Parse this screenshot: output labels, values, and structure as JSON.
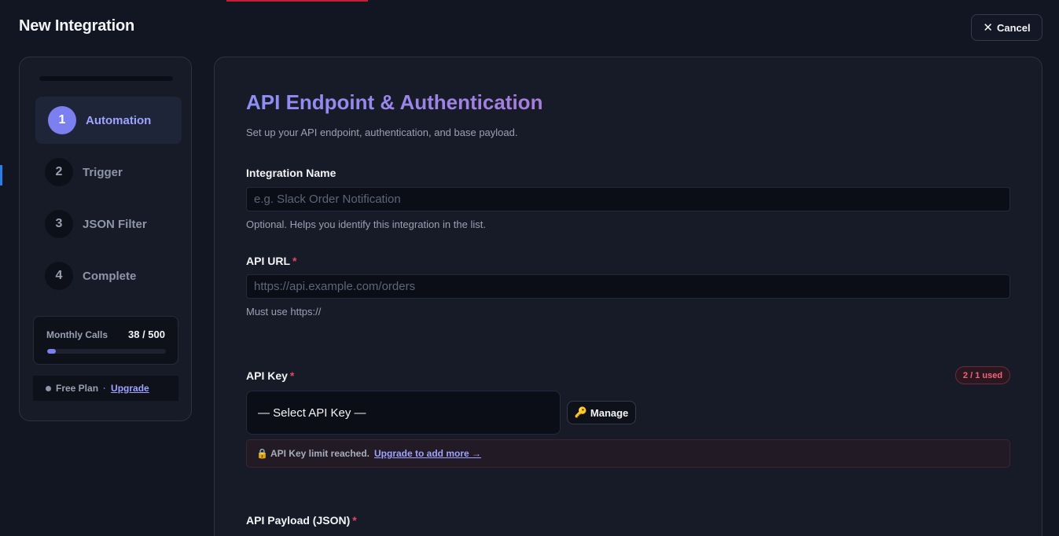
{
  "header": {
    "title": "New Integration",
    "cancel_label": "Cancel"
  },
  "sidebar": {
    "steps": [
      {
        "number": "1",
        "label": "Automation",
        "active": true
      },
      {
        "number": "2",
        "label": "Trigger",
        "active": false
      },
      {
        "number": "3",
        "label": "JSON Filter",
        "active": false
      },
      {
        "number": "4",
        "label": "Complete",
        "active": false
      }
    ],
    "usage": {
      "label": "Monthly Calls",
      "count": "38 / 500",
      "fraction": 0.076
    },
    "plan": {
      "name": "Free Plan",
      "separator": "·",
      "upgrade_label": "Upgrade"
    }
  },
  "main": {
    "title": "API Endpoint & Authentication",
    "subtitle": "Set up your API endpoint, authentication, and base payload.",
    "integration_name": {
      "label": "Integration Name",
      "placeholder": "e.g. Slack Order Notification",
      "value": "",
      "help": "Optional. Helps you identify this integration in the list."
    },
    "api_url": {
      "label": "API URL",
      "required_mark": "*",
      "placeholder": "https://api.example.com/orders",
      "value": "",
      "help": "Must use https://"
    },
    "api_key": {
      "label": "API Key",
      "required_mark": "*",
      "usage_badge": "2 / 1 used",
      "selected": "— Select API Key —",
      "manage_label": "Manage",
      "manage_icon": "key-icon",
      "limit_icon": "lock-icon",
      "limit_text": "API Key limit reached.",
      "limit_link": "Upgrade to add more →"
    },
    "payload": {
      "label": "API Payload (JSON)",
      "required_mark": "*"
    }
  },
  "colors": {
    "accent": "#7c7ff0",
    "accent_text": "#9ea3ff",
    "danger": "#e2485a",
    "background": "#121522",
    "panel": "#171b28"
  }
}
